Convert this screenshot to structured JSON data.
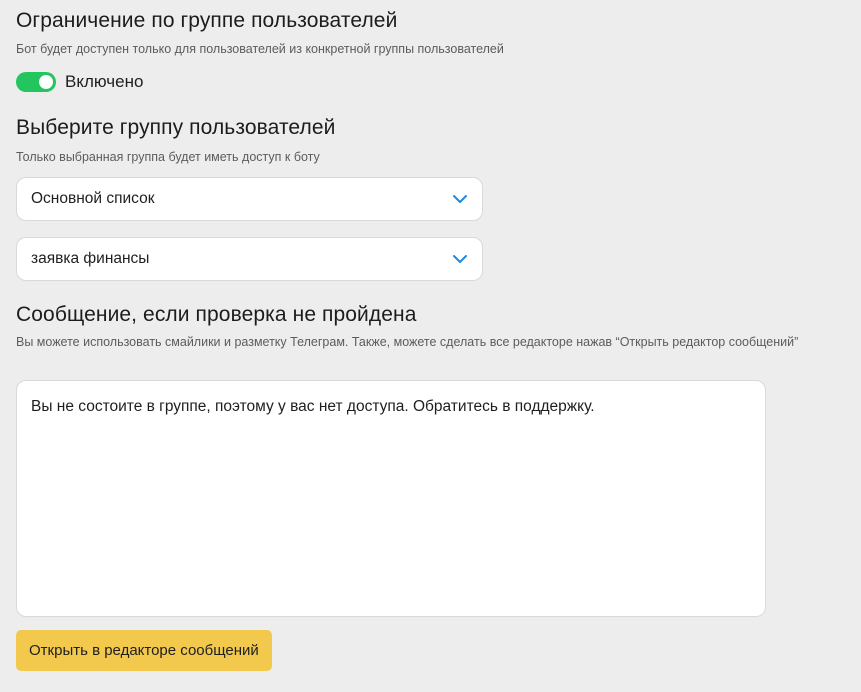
{
  "group_restriction": {
    "title": "Ограничение по группе пользователей",
    "description": "Бот будет доступен только для пользователей из конкретной группы пользователей",
    "toggle": {
      "state": "on",
      "label": "Включено",
      "color": "#22c55e"
    }
  },
  "group_select": {
    "title": "Выберите группу пользователей",
    "description": "Только выбранная группа будет иметь доступ к боту",
    "selects": [
      {
        "value": "Основной список",
        "icon": "chevron-down-icon"
      },
      {
        "value": "заявка финансы",
        "icon": "chevron-down-icon"
      }
    ],
    "chevron_color": "#1e88e5"
  },
  "fail_message": {
    "title": "Сообщение, если проверка не пройдена",
    "description": "Вы можете использовать смайлики и разметку Телеграм. Также, можете сделать все редакторе нажав “Открыть редактор сообщений”",
    "text": "Вы не состоите в группе, поэтому у вас нет доступа. Обратитесь в поддержку.",
    "button_label": "Открыть в редакторе сообщений",
    "button_color": "#f2c94c"
  }
}
